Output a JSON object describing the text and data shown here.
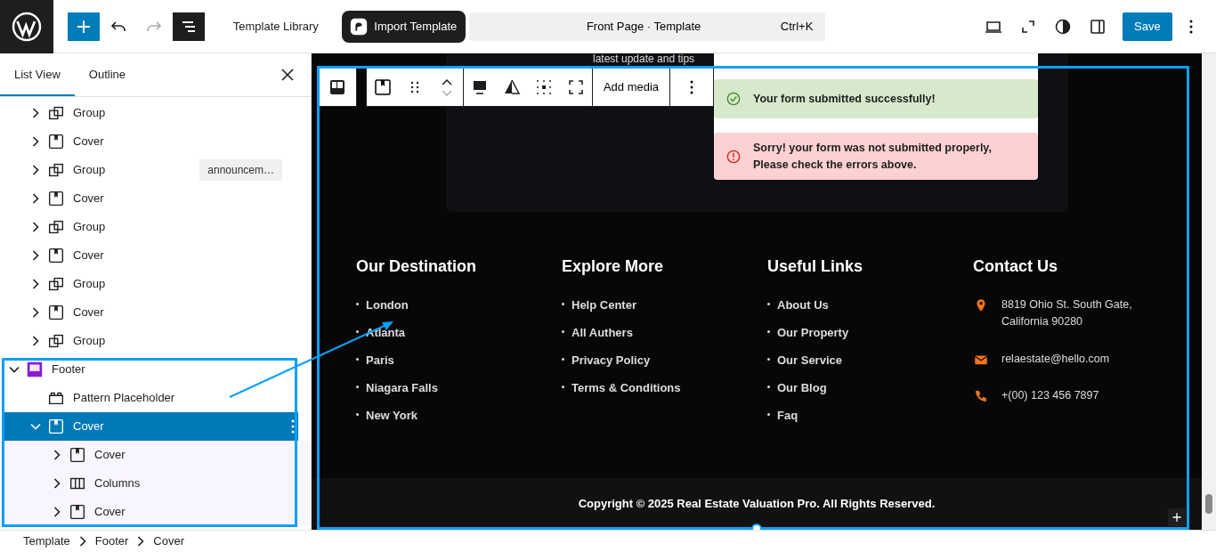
{
  "top_bar": {
    "library_link": "Template Library",
    "import_button": "Import Template",
    "command_bar": {
      "title": "Front Page · Template",
      "shortcut": "Ctrl+K"
    },
    "save_button": "Save"
  },
  "sidebar": {
    "tabs": [
      {
        "label": "List View",
        "selected": true
      },
      {
        "label": "Outline",
        "selected": false
      }
    ],
    "scrolled_items": [
      {
        "kind": "group",
        "label": "Group",
        "expanded": false,
        "selected": false
      },
      {
        "kind": "cover",
        "label": "Cover",
        "expanded": false,
        "selected": false
      },
      {
        "kind": "group",
        "label": "Group",
        "expanded": false,
        "selected": false,
        "badge": "announcem…"
      },
      {
        "kind": "cover",
        "label": "Cover",
        "expanded": false,
        "selected": false
      },
      {
        "kind": "group",
        "label": "Group",
        "expanded": false,
        "selected": false
      },
      {
        "kind": "cover",
        "label": "Cover",
        "expanded": false,
        "selected": false
      },
      {
        "kind": "group",
        "label": "Group",
        "expanded": false,
        "selected": false
      },
      {
        "kind": "cover",
        "label": "Cover",
        "expanded": false,
        "selected": false
      },
      {
        "kind": "group",
        "label": "Group",
        "expanded": false,
        "selected": false
      }
    ],
    "items": [
      {
        "kind": "footer",
        "label": "Footer",
        "expanded": true,
        "selected": false,
        "children": [
          {
            "kind": "pattern",
            "label": "Pattern Placeholder",
            "selected": false
          },
          {
            "kind": "cover",
            "label": "Cover",
            "expanded": true,
            "selected": true,
            "children": [
              {
                "kind": "cover",
                "label": "Cover",
                "expanded": false,
                "selected": false
              },
              {
                "kind": "columns",
                "label": "Columns",
                "expanded": false,
                "selected": false
              },
              {
                "kind": "cover",
                "label": "Cover",
                "expanded": false,
                "selected": false
              }
            ]
          }
        ]
      }
    ]
  },
  "canvas": {
    "cut_text": "latest update and tips",
    "block_toolbar": {
      "add_media": "Add media"
    },
    "notices": [
      {
        "kind": "success",
        "text": "Your form submitted successfully!"
      },
      {
        "kind": "error",
        "text": "Sorry! your form was not submitted properly, Please check the errors above."
      }
    ],
    "footer_columns": [
      {
        "heading": "Our Destination",
        "links": [
          "London",
          "Atlanta",
          "Paris",
          "Niagara Falls",
          "New York"
        ]
      },
      {
        "heading": "Explore More",
        "links": [
          "Help Center",
          "All Authers",
          "Privacy Policy",
          "Terms & Conditions"
        ]
      },
      {
        "heading": "Useful Links",
        "links": [
          "About Us",
          "Our Property",
          "Our Service",
          "Our Blog",
          "Faq"
        ]
      },
      {
        "heading": "Contact Us",
        "contacts": [
          {
            "kind": "location",
            "text": "8819 Ohio St. South Gate, California 90280"
          },
          {
            "kind": "email",
            "text": "relaestate@hello.com"
          },
          {
            "kind": "phone",
            "text": "+(00) 123 456 7897"
          }
        ]
      }
    ],
    "copyright": "Copyright © 2025 Real Estate Valuation Pro. All Rights Reserved."
  },
  "breadcrumb": [
    "Template",
    "Footer",
    "Cover"
  ]
}
